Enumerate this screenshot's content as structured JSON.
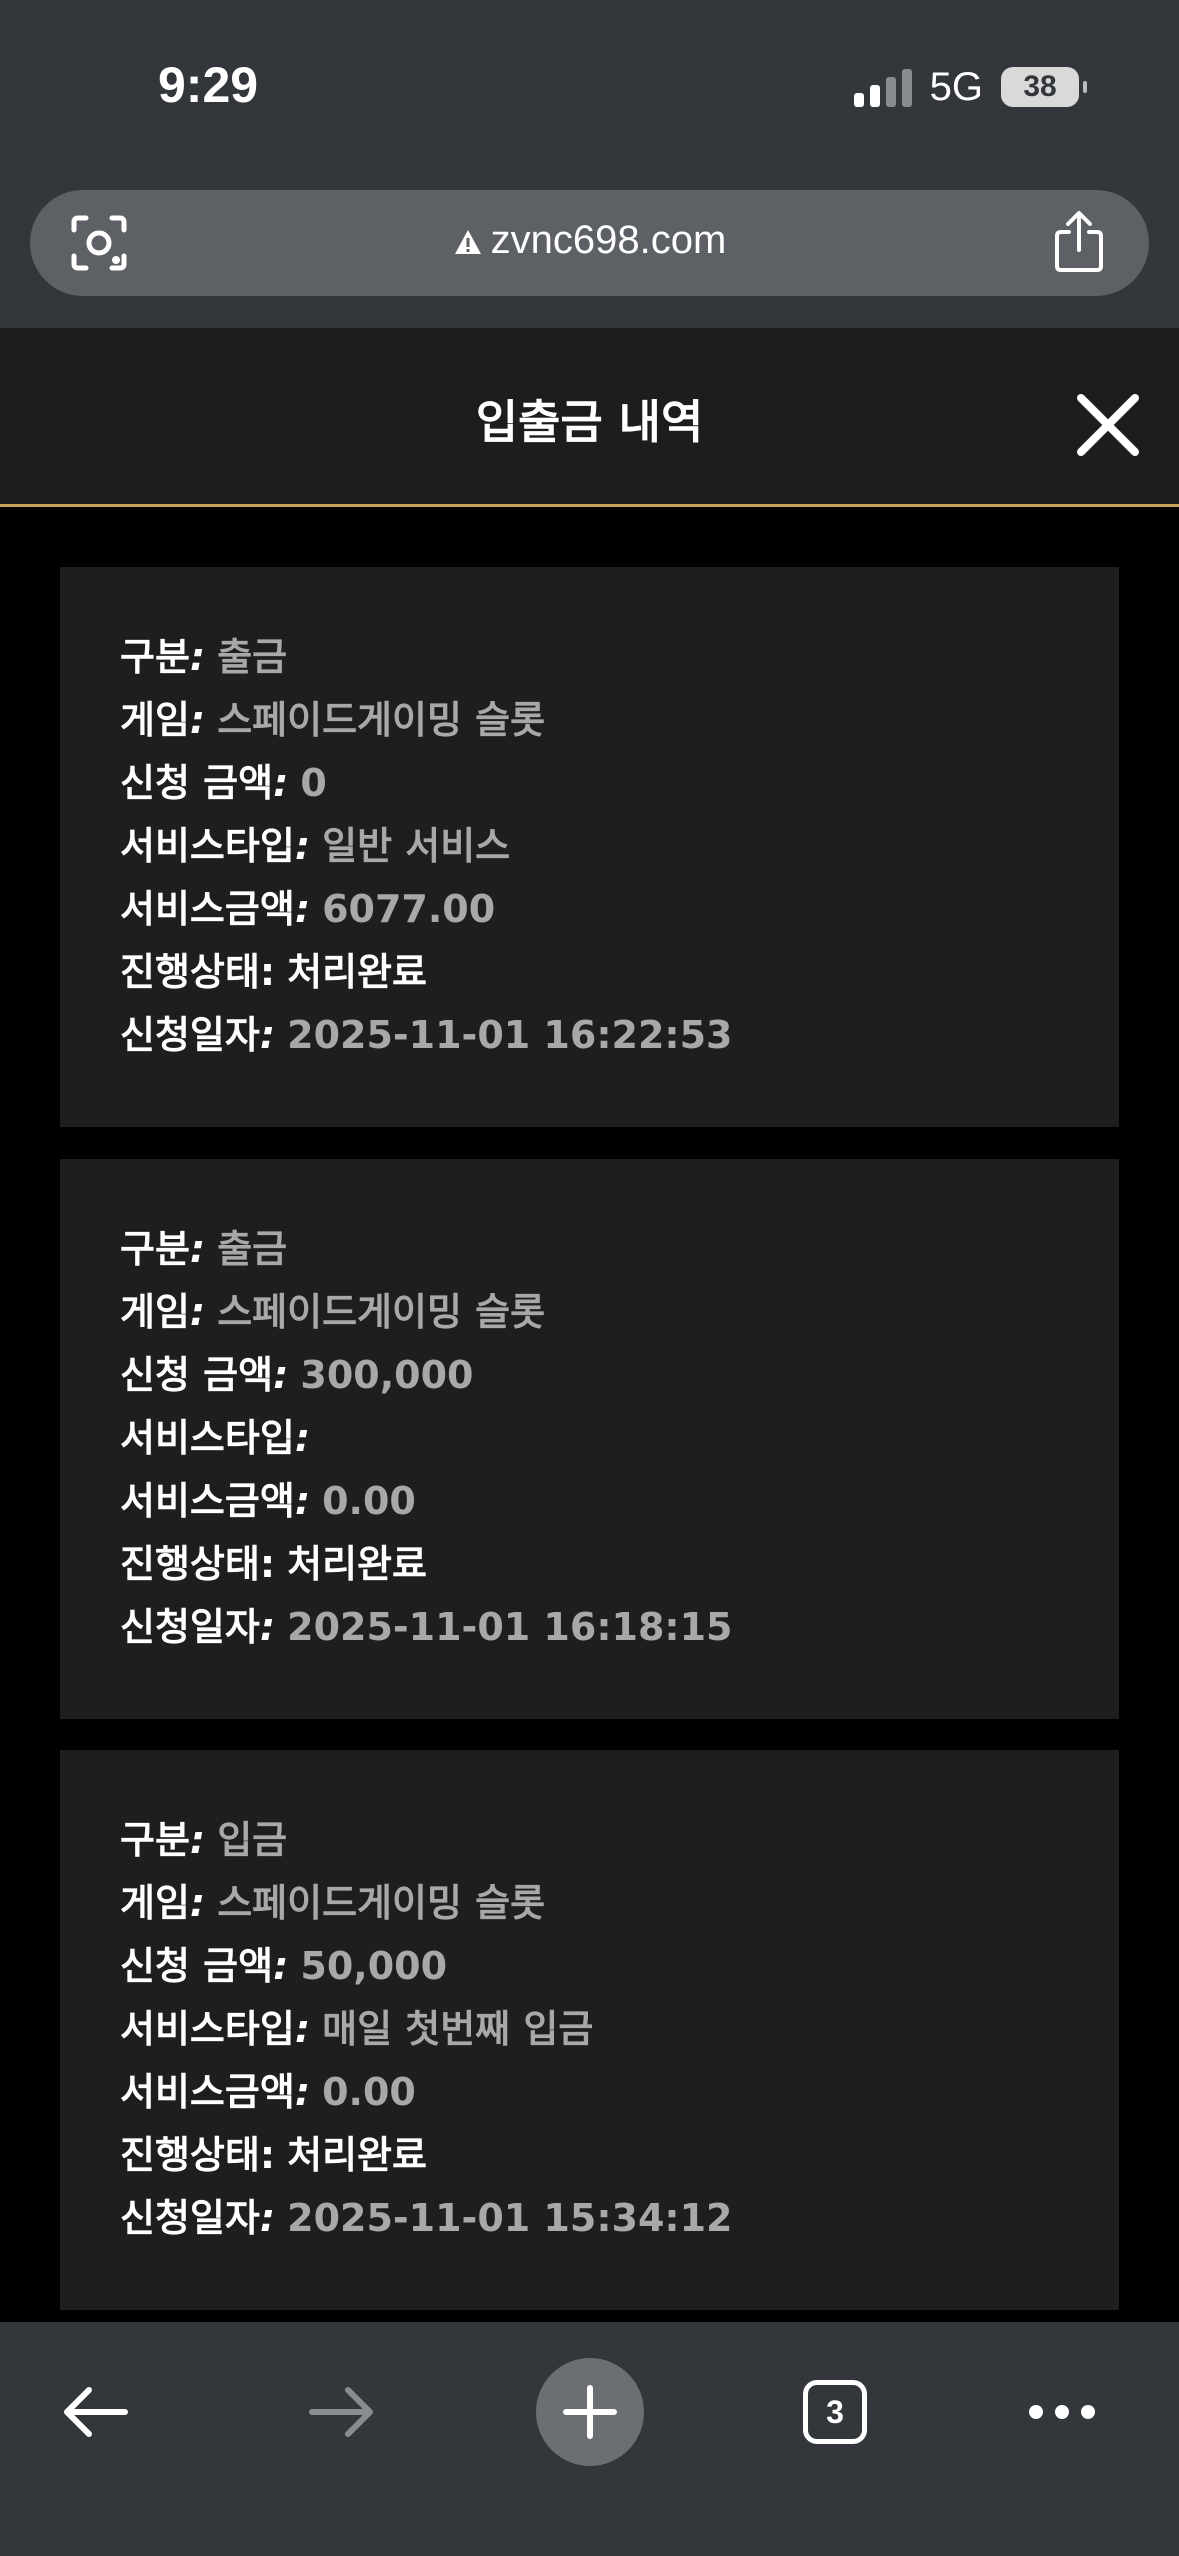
{
  "status_bar": {
    "time": "9:29",
    "network": "5G",
    "battery": "38"
  },
  "browser": {
    "url": "zvnc698.com",
    "tab_count": "3"
  },
  "dialog": {
    "title": "입출금 내역"
  },
  "records": [
    {
      "type_label": "구분",
      "type_value": "출금",
      "game_label": "게임",
      "game_value": "스페이드게이밍 슬롯",
      "amount_label": "신청 금액",
      "amount_value": "0",
      "service_type_label": "서비스타입",
      "service_type_value": "일반 서비스",
      "service_amount_label": "서비스금액",
      "service_amount_value": "6077.00",
      "status_label": "진행상태",
      "status_value": "처리완료",
      "date_label": "신청일자",
      "date_value": "2025-11-01 16:22:53"
    },
    {
      "type_label": "구분",
      "type_value": "출금",
      "game_label": "게임",
      "game_value": "스페이드게이밍 슬롯",
      "amount_label": "신청 금액",
      "amount_value": "300,000",
      "service_type_label": "서비스타입",
      "service_type_value": "",
      "service_amount_label": "서비스금액",
      "service_amount_value": "0.00",
      "status_label": "진행상태",
      "status_value": "처리완료",
      "date_label": "신청일자",
      "date_value": "2025-11-01 16:18:15"
    },
    {
      "type_label": "구분",
      "type_value": "입금",
      "game_label": "게임",
      "game_value": "스페이드게이밍 슬롯",
      "amount_label": "신청 금액",
      "amount_value": "50,000",
      "service_type_label": "서비스타입",
      "service_type_value": "매일 첫번째 입금",
      "service_amount_label": "서비스금액",
      "service_amount_value": "0.00",
      "status_label": "진행상태",
      "status_value": "처리완료",
      "date_label": "신청일자",
      "date_value": "2025-11-01 15:34:12"
    }
  ],
  "icons": {
    "lens": "camera-lens-icon",
    "warning": "warning-icon",
    "share": "share-icon",
    "close": "close-icon",
    "back": "arrow-left-icon",
    "forward": "arrow-right-icon",
    "new_tab": "plus-icon",
    "tabs": "tabs-icon",
    "more": "more-icon"
  },
  "colors": {
    "accent_line": "#c5a45a",
    "value_gray": "#a8a8a8",
    "card_bg": "#1e1e1f",
    "chrome_bg": "#33363a"
  }
}
